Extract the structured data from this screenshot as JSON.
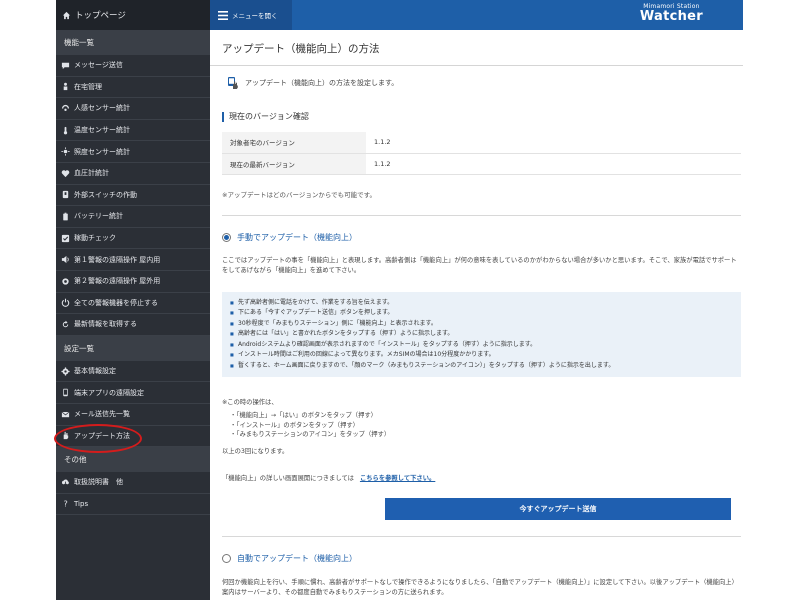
{
  "sidebar": {
    "top": {
      "label": "トップページ",
      "icon": "home-icon"
    },
    "section1": "機能一覧",
    "items1": [
      {
        "label": "メッセージ送信",
        "icon": "chat-icon"
      },
      {
        "label": "在宅管理",
        "icon": "person-icon"
      },
      {
        "label": "人感センサー統計",
        "icon": "sensor-icon"
      },
      {
        "label": "温度センサー統計",
        "icon": "thermometer-icon"
      },
      {
        "label": "照度センサー統計",
        "icon": "sun-icon"
      },
      {
        "label": "血圧計統計",
        "icon": "heart-icon"
      },
      {
        "label": "外部スイッチの作動",
        "icon": "switch-icon"
      },
      {
        "label": "バッテリー統計",
        "icon": "battery-icon"
      },
      {
        "label": "稼動チェック",
        "icon": "check-icon"
      },
      {
        "label": "第１警報の遠隔操作 屋内用",
        "icon": "speaker-icon"
      },
      {
        "label": "第２警報の遠隔操作 屋外用",
        "icon": "alarm-icon"
      },
      {
        "label": "全ての警報機器を停止する",
        "icon": "power-icon"
      },
      {
        "label": "最新情報を取得する",
        "icon": "refresh-icon"
      }
    ],
    "section2": "設定一覧",
    "items2": [
      {
        "label": "基本情報設定",
        "icon": "gear-icon"
      },
      {
        "label": "端末アプリの遠隔設定",
        "icon": "phone-icon"
      },
      {
        "label": "メール送信先一覧",
        "icon": "mail-icon"
      },
      {
        "label": "アップデート方法",
        "icon": "hand-icon"
      }
    ],
    "section3": "その他",
    "items3": [
      {
        "label": "取扱説明書　他",
        "icon": "cloud-download-icon"
      },
      {
        "label": "Tips",
        "icon": "question-icon"
      }
    ]
  },
  "topbar": {
    "menu_label": "メニューを開く",
    "brand_sub": "Mimamori Station",
    "brand_main": "Watcher"
  },
  "main": {
    "title": "アップデート（機能向上）の方法",
    "description": "アップデート（機能向上）の方法を設定します。",
    "version_section": "現在のバージョン確認",
    "versions": [
      {
        "label": "対象者宅のバージョン",
        "value": "1.1.2"
      },
      {
        "label": "現在の最新バージョン",
        "value": "1.1.2"
      }
    ],
    "version_note": "※アップデートはどのバージョンからでも可能です。",
    "manual": {
      "title": "手動でアップデート（機能向上）",
      "paragraph": "ここではアップデートの事を「機能向上」と表現します。高齢者側は「機能向上」が何の意味を表しているのかがわからない場合が多いかと思います。そこで、家族が電話でサポートをしてあげながら「機能向上」を進めて下さい。",
      "steps": [
        "先ず高齢者側に電話をかけて、作業をする旨を伝えます。",
        "下にある「今すぐアップデート送信」ボタンを押します。",
        "30秒程度で「みまもりステーション」側に「機能向上」と表示されます。",
        "高齢者には「はい」と書かれたボタンをタップする（押す）ように指示します。",
        "Androidシステムより確認画面が表示されますので「インストール」をタップする（押す）ように指示します。",
        "インストール時間はご利用の回線によって異なります。メカSIMの場合は10分程度かかります。",
        "暫くすると、ホーム画面に戻りますので、「顔のマーク（みまもりステーションのアイコン）」をタップする（押す）ように指示を出します。"
      ],
      "ops_note": "※この時の操作は、",
      "ops": [
        "・「機能向上」→「はい」のボタンをタップ（押す）",
        "・「インストール」のボタンをタップ（押す）",
        "・「みまもりステーションのアイコン」をタップ（押す）"
      ],
      "count_note": "以上の3回になります。",
      "link_prefix": "「機能向上」の詳しい画面展開につきましては",
      "link_text": "こちらを参照して下さい。",
      "send_button": "今すぐアップデート送信"
    },
    "auto": {
      "title": "自動でアップデート（機能向上）",
      "paragraph": "何回か機能向上を行い、手順に慣れ、高齢者がサポートなしで操作できるようになりましたら、「自動でアップデート（機能向上）」に設定して下さい。以後アップデート（機能向上）案内はサーバーより、その都度自動でみまもりステーションの方に送られます。"
    }
  },
  "colors": {
    "accent": "#1e5fa8",
    "sidebar_bg": "#2b2f36",
    "highlight": "#d41c1c"
  }
}
